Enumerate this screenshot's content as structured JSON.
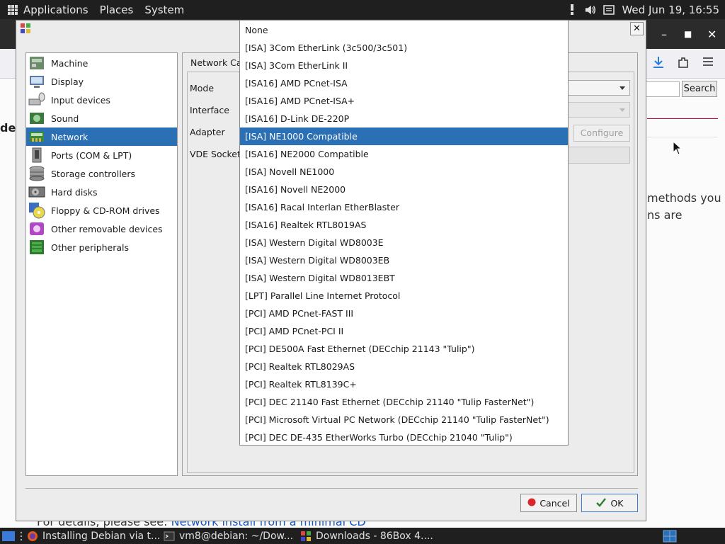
{
  "top_panel": {
    "menus": [
      "Applications",
      "Places",
      "System"
    ],
    "clock": "Wed Jun 19, 16:55"
  },
  "background_browser": {
    "search_button": "Search",
    "text_line1": "methods you",
    "text_line2": "ns are",
    "footer_text": "For details, please see:",
    "footer_link": "Network install from a minimal CD",
    "logo_fragment": "de"
  },
  "dialog": {
    "categories": [
      {
        "label": "Machine",
        "icon": "machine-icon"
      },
      {
        "label": "Display",
        "icon": "display-icon"
      },
      {
        "label": "Input devices",
        "icon": "input-devices-icon"
      },
      {
        "label": "Sound",
        "icon": "sound-icon"
      },
      {
        "label": "Network",
        "icon": "network-icon"
      },
      {
        "label": "Ports (COM & LPT)",
        "icon": "ports-icon"
      },
      {
        "label": "Storage controllers",
        "icon": "storage-controllers-icon"
      },
      {
        "label": "Hard disks",
        "icon": "hard-disks-icon"
      },
      {
        "label": "Floppy & CD-ROM drives",
        "icon": "floppy-cdrom-icon"
      },
      {
        "label": "Other removable devices",
        "icon": "removable-devices-icon"
      },
      {
        "label": "Other peripherals",
        "icon": "peripherals-icon"
      }
    ],
    "selected_category": "Network",
    "tab_label": "Network Car",
    "fields": {
      "mode": "Mode",
      "interface": "Interface",
      "adapter": "Adapter",
      "vde_socket": "VDE Socket"
    },
    "configure_button": "Configure",
    "cancel_button": "Cancel",
    "ok_button": "OK"
  },
  "adapter_dropdown": {
    "selected": "[ISA] NE1000 Compatible",
    "options": [
      "None",
      "[ISA] 3Com EtherLink (3c500/3c501)",
      "[ISA] 3Com EtherLink II",
      "[ISA16] AMD PCnet-ISA",
      "[ISA16] AMD PCnet-ISA+",
      "[ISA16] D-Link DE-220P",
      "[ISA] NE1000 Compatible",
      "[ISA16] NE2000 Compatible",
      "[ISA] Novell NE1000",
      "[ISA16] Novell NE2000",
      "[ISA16] Racal Interlan EtherBlaster",
      "[ISA16] Realtek RTL8019AS",
      "[ISA] Western Digital WD8003E",
      "[ISA] Western Digital WD8003EB",
      "[ISA] Western Digital WD8013EBT",
      "[LPT] Parallel Line Internet Protocol",
      "[PCI] AMD PCnet-FAST III",
      "[PCI] AMD PCnet-PCI II",
      "[PCI] DE500A Fast Ethernet (DECchip 21143 \"Tulip\")",
      "[PCI] Realtek RTL8029AS",
      "[PCI] Realtek RTL8139C+",
      "[PCI] DEC 21140 Fast Ethernet (DECchip 21140 \"Tulip FasterNet\")",
      "[PCI] Microsoft Virtual PC Network (DECchip 21140 \"Tulip FasterNet\")",
      "[PCI] DEC DE-435 EtherWorks Turbo (DECchip 21040 \"Tulip\")"
    ]
  },
  "taskbar": {
    "items": [
      {
        "label": "Installing Debian via t...",
        "icon": "firefox-icon"
      },
      {
        "label": "vm8@debian: ~/Dow...",
        "icon": "terminal-icon"
      },
      {
        "label": "Downloads - 86Box 4....",
        "icon": "86box-icon"
      }
    ]
  },
  "colors": {
    "selection": "#2b6fb4",
    "panel": "#1f1f1f",
    "dialog_bg": "#ececec"
  }
}
